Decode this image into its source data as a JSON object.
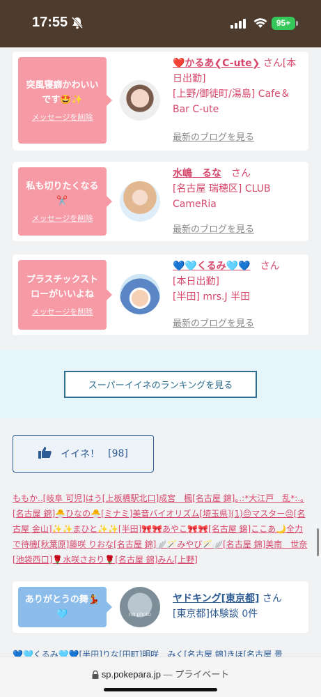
{
  "status": {
    "time": "17:55",
    "battery": "95+"
  },
  "cards": [
    {
      "message": "突風寝癖かわいいです🤩✨",
      "delete": "メッセージを削除",
      "name": "❤️かるあ❮C-ute❯",
      "san": "さん",
      "info": [
        "[本日出勤]",
        "[上野/御徒町/湯島] Cafe＆Bar C-ute"
      ],
      "blog": "最新のブログを見る"
    },
    {
      "message": "私も切りたくなる✂️",
      "delete": "メッセージを削除",
      "name": "水嶋　るな",
      "san": "さん",
      "info": [
        "[名古屋 瑞穂区] CLUB CameRia"
      ],
      "blog": "最新のブログを見る"
    },
    {
      "message": "プラスチックストローがいいよね",
      "delete": "メッセージを削除",
      "name": "💙🩵くるみ🩵💙",
      "san": "さん",
      "info": [
        "[本日出勤]",
        "[半田] mrs.J 半田"
      ],
      "blog": "最新のブログを見る"
    },
    {
      "message": "ありがとうの舞💃🩵",
      "name": "ヤドキング[東京都]",
      "san": "さん",
      "info": [
        "[東京都]体験談 0件"
      ],
      "avatar_text": "no photo"
    }
  ],
  "ranking_button": "スーパーイイネのランキングを見る",
  "like": {
    "label": "イイネ！",
    "count": "[98]"
  },
  "like_names": "ももか..[岐阜 可児]はう[上板橋駅北口]成宮　楓[名古屋 錦]｡.:*大江戸　乱*:.｡[名古屋 錦]🐣ひなの🐣[ミナミ]美音バイオリズム[埼玉県](1)😔マスター😔[名古屋 金山]✨✨まひと✨✨[半田]🎀🎀あやこ🎀🎀[名古屋 錦]ここあ🌙全力で待機[秋葉原]藤咲 りおな[名古屋 錦]🪽🪄みやび🪄🪽[名古屋 錦]美南　世奈[池袋西口]🌹水咲さおり🌹[名古屋 錦]みん[上野]",
  "like_names2": "💙🩵くるみ🩵💙[半田]りな[田町]明咲　みく[名古屋 錦]きほ[名古屋 景",
  "browser": {
    "url": "sp.pokepara.jp",
    "private": "— プライベート"
  },
  "colors": {
    "accent_pink": "#f69aa6",
    "link_pink": "#d6476b",
    "accent_blue": "#2d5b94"
  }
}
